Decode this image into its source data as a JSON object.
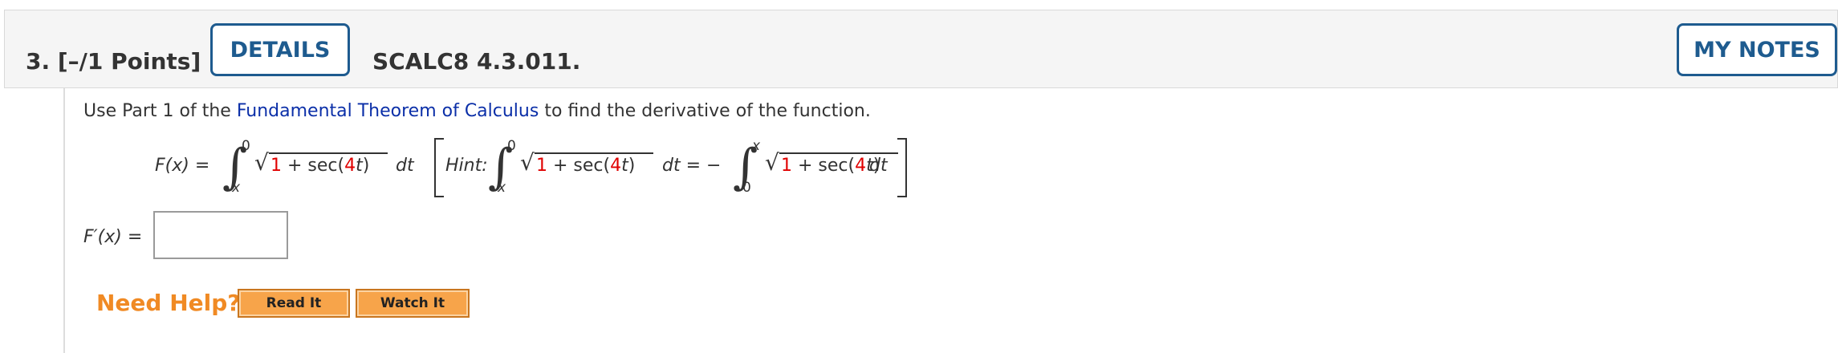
{
  "header": {
    "question_number": "3. [–/1 Points]",
    "details_label": "DETAILS",
    "problem_code": "SCALC8 4.3.011.",
    "my_notes_label": "MY NOTES"
  },
  "question": {
    "prompt_before": "Use Part 1 of the ",
    "prompt_link": "Fundamental Theorem of Calculus",
    "prompt_after": " to find the derivative of the function.",
    "function_lhs": "F(x) =",
    "int_upper": "0",
    "int_lower": "x",
    "integrand_1": "1",
    "integrand_plus": " + sec(",
    "integrand_4": "4",
    "integrand_t": "t",
    "integrand_close": ")",
    "dt": "dt",
    "hint_label": "Hint:",
    "hint_eq": "dt = −",
    "hint_int2_upper": "x",
    "hint_int2_lower": "0",
    "answer_label": "F′(x) =",
    "answer_value": ""
  },
  "help": {
    "need_help_label": "Need Help?",
    "read_it_label": "Read It",
    "watch_it_label": "Watch It"
  },
  "colors": {
    "accent_blue": "#1e5b8f",
    "link_blue": "#0b2fa8",
    "help_orange": "#f08a24",
    "highlight_red": "#e00000"
  }
}
